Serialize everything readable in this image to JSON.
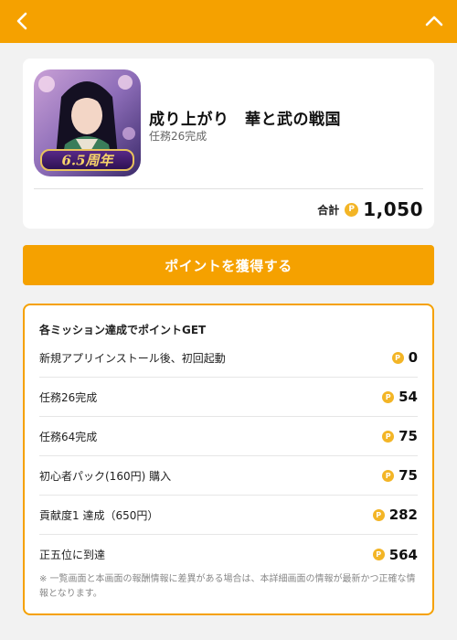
{
  "header": {
    "back_icon": "chevron-left-icon",
    "collapse_icon": "chevron-up-icon",
    "background": "#f5a100"
  },
  "app": {
    "title": "成り上がり　華と武の戦国",
    "subtitle": "任務26完成",
    "icon_badge": "6.5周年",
    "total_label": "合計",
    "total_value": "1,050",
    "coin_symbol": "P"
  },
  "cta": {
    "label": "ポイントを獲得する"
  },
  "missions": {
    "heading": "各ミッション達成でポイントGET",
    "items": [
      {
        "label": "新規アプリインストール後、初回起動",
        "points": "0"
      },
      {
        "label": "任務26完成",
        "points": "54"
      },
      {
        "label": "任務64完成",
        "points": "75"
      },
      {
        "label": "初心者パック(160円) 購入",
        "points": "75"
      },
      {
        "label": "貢献度1 達成（650円）",
        "points": "282"
      },
      {
        "label": "正五位に到達",
        "points": "564"
      }
    ],
    "note": "※ 一覧画面と本画面の報酬情報に差異がある場合は、本詳細画面の情報が最新かつ正確な情報となります。"
  },
  "colors": {
    "accent": "#f5a100",
    "coin": "#f3b526",
    "page_bg": "#f2f2f2"
  }
}
